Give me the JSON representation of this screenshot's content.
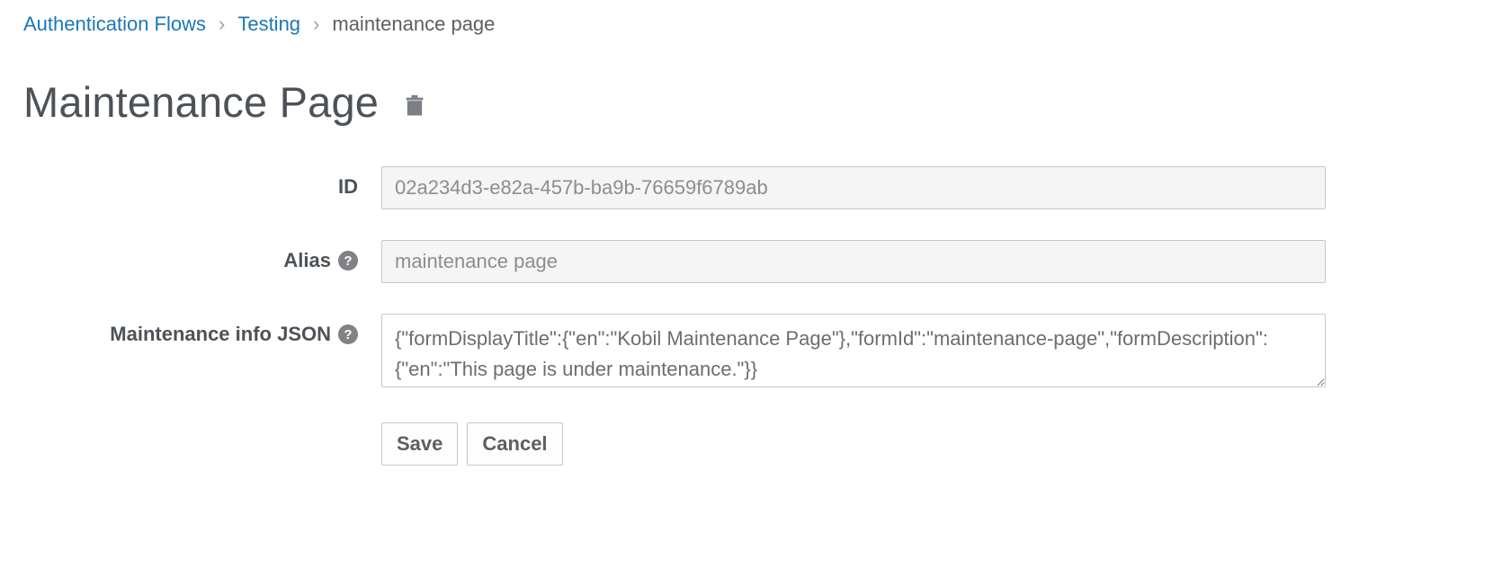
{
  "breadcrumb": {
    "items": [
      {
        "label": "Authentication Flows"
      },
      {
        "label": "Testing"
      }
    ],
    "current": "maintenance page"
  },
  "title": "Maintenance Page",
  "form": {
    "id": {
      "label": "ID",
      "value": "02a234d3-e82a-457b-ba9b-76659f6789ab"
    },
    "alias": {
      "label": "Alias",
      "value": "maintenance page"
    },
    "maintenance_json": {
      "label": "Maintenance info JSON",
      "value": "{\"formDisplayTitle\":{\"en\":\"Kobil Maintenance Page\"},\"formId\":\"maintenance-page\",\"formDescription\":{\"en\":\"This page is under maintenance.\"}}"
    }
  },
  "buttons": {
    "save": "Save",
    "cancel": "Cancel"
  }
}
